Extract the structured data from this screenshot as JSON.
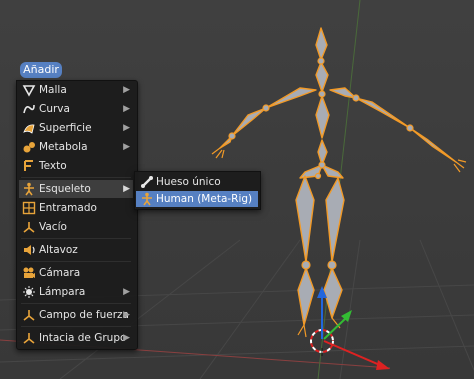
{
  "add_menu": {
    "button_label": "Añadir",
    "items": [
      {
        "label": "Malla",
        "icon": "mesh-icon",
        "has_submenu": true
      },
      {
        "label": "Curva",
        "icon": "curve-icon",
        "has_submenu": true
      },
      {
        "label": "Superficie",
        "icon": "surface-icon",
        "has_submenu": true
      },
      {
        "label": "Metabola",
        "icon": "metaball-icon",
        "has_submenu": true
      },
      {
        "label": "Texto",
        "icon": "text-icon",
        "has_submenu": false
      },
      {
        "label": "Esqueleto",
        "icon": "armature-icon",
        "has_submenu": true
      },
      {
        "label": "Entramado",
        "icon": "lattice-icon",
        "has_submenu": false
      },
      {
        "label": "Vacío",
        "icon": "empty-icon",
        "has_submenu": false
      },
      {
        "label": "Altavoz",
        "icon": "speaker-icon",
        "has_submenu": false
      },
      {
        "label": "Cámara",
        "icon": "camera-icon",
        "has_submenu": false
      },
      {
        "label": "Lámpara",
        "icon": "lamp-icon",
        "has_submenu": true
      },
      {
        "label": "Campo de fuerza",
        "icon": "force-field-icon",
        "has_submenu": true
      },
      {
        "label": "Intacia de Grupo",
        "icon": "group-instance-icon",
        "has_submenu": true
      }
    ]
  },
  "armature_submenu": {
    "items": [
      {
        "label": "Hueso único",
        "icon": "single-bone-icon"
      },
      {
        "label": "Human (Meta-Rig)",
        "icon": "human-rig-icon"
      }
    ]
  },
  "colors": {
    "accent": "#5680c2",
    "viewport_bg": "#3b3b3b",
    "bone_fill": "#a8acb4",
    "bone_outline": "#f29a27"
  }
}
